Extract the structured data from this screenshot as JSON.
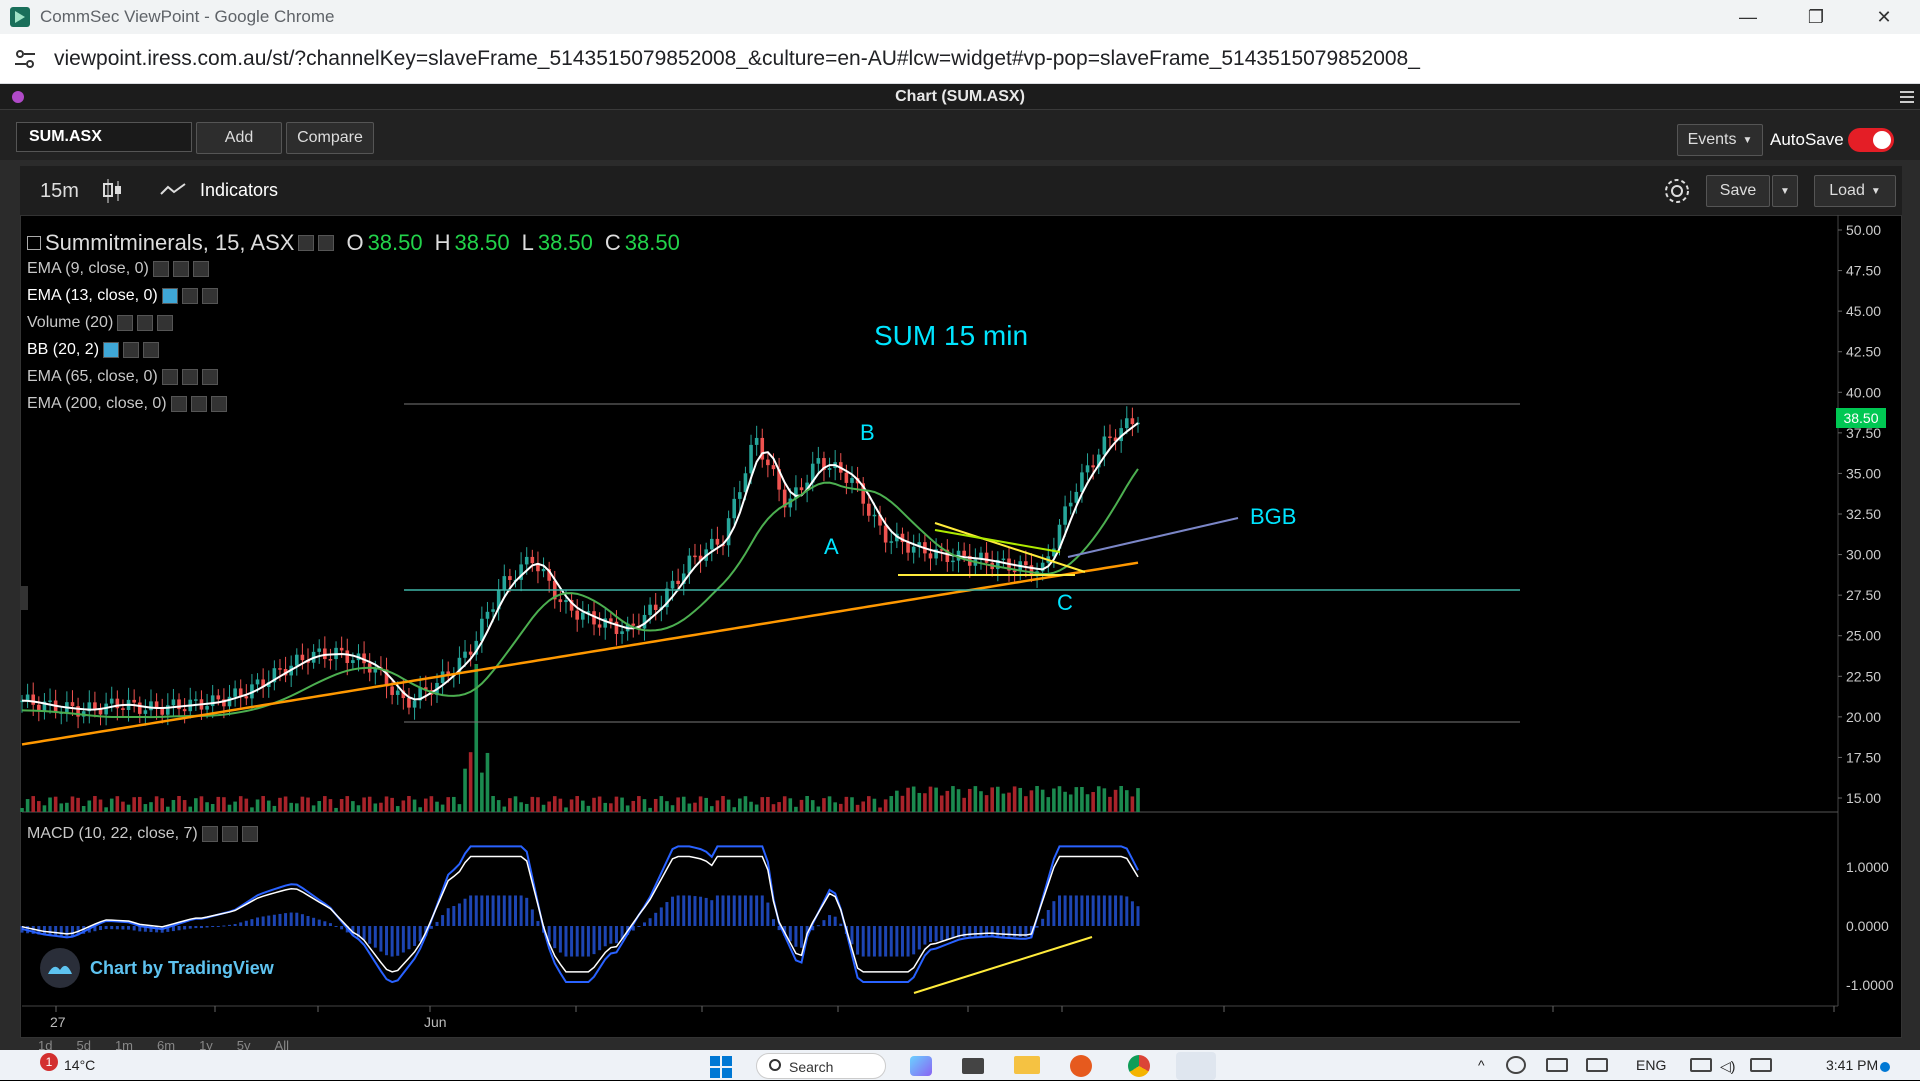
{
  "browser": {
    "title": "CommSec ViewPoint - Google Chrome",
    "url": "viewpoint.iress.com.au/st/?channelKey=slaveFrame_5143515079852008_&culture=en-AU#lcw=widget#vp-pop=slaveFrame_5143515079852008_"
  },
  "panel": {
    "title": "Chart (SUM.ASX)"
  },
  "toolbar": {
    "symbol": "SUM.ASX",
    "add_label": "Add",
    "compare_label": "Compare",
    "events_label": "Events",
    "autosave_label": "AutoSave"
  },
  "chart_toolbar": {
    "interval": "15m",
    "indicators_label": "Indicators",
    "save_label": "Save",
    "load_label": "Load"
  },
  "legend": {
    "symbol_line": "Summitminerals, 15, ASX",
    "o_label": "O",
    "o_val": "38.50",
    "h_label": "H",
    "h_val": "38.50",
    "l_label": "L",
    "l_val": "38.50",
    "c_label": "C",
    "c_val": "38.50",
    "indicators": [
      "EMA (9, close, 0)",
      "EMA (13, close, 0)",
      "Volume (20)",
      "BB (20, 2)",
      "EMA (65, close, 0)",
      "EMA (200, close, 0)"
    ],
    "macd": "MACD (10, 22, close, 7)"
  },
  "annotations": {
    "title": "SUM 15 min",
    "a": "A",
    "b": "B",
    "c": "C",
    "bgb": "BGB"
  },
  "price_axis": [
    "50.00",
    "47.50",
    "45.00",
    "42.50",
    "40.00",
    "37.50",
    "35.00",
    "32.50",
    "30.00",
    "27.50",
    "25.00",
    "22.50",
    "20.00",
    "17.50",
    "15.00"
  ],
  "price_badge": "38.50",
  "macd_axis": [
    "1.0000",
    "0.0000",
    "-1.0000"
  ],
  "time_axis": {
    "t1": "27",
    "t2": "Jun"
  },
  "ranges": [
    "1d",
    "5d",
    "1m",
    "6m",
    "1y",
    "5y",
    "All"
  ],
  "watermark": "Chart by TradingView",
  "taskbar": {
    "weather": "14°C",
    "weather_badge": "1",
    "search": "Search",
    "lang": "ENG",
    "time": "3:41 PM"
  },
  "colors": {
    "up": "#26a69a",
    "down": "#ef5350",
    "ema9": "#ffffff",
    "ema65": "#4caf50",
    "ema200": "#ff9800",
    "annotation": "#00e5ff",
    "trendline": "#ffeb3b",
    "price_badge": "#00c853"
  },
  "chart_data": {
    "type": "line",
    "series": [
      {
        "values": [
          21.0,
          20.6,
          20.4,
          20.8,
          20.5,
          20.7,
          20.9,
          21.5,
          22.7,
          23.8,
          23.9,
          23.1,
          20.8,
          22.0,
          23.9,
          28.0,
          29.8,
          26.8,
          25.9,
          25.3,
          27.0,
          29.7,
          31.0,
          37.2,
          33.0,
          35.8,
          34.7,
          31.2,
          30.4,
          29.9,
          29.7,
          29.3,
          29.0,
          34.0,
          37.0,
          38.5
        ]
      }
    ],
    "ylim": [
      15,
      50
    ]
  }
}
